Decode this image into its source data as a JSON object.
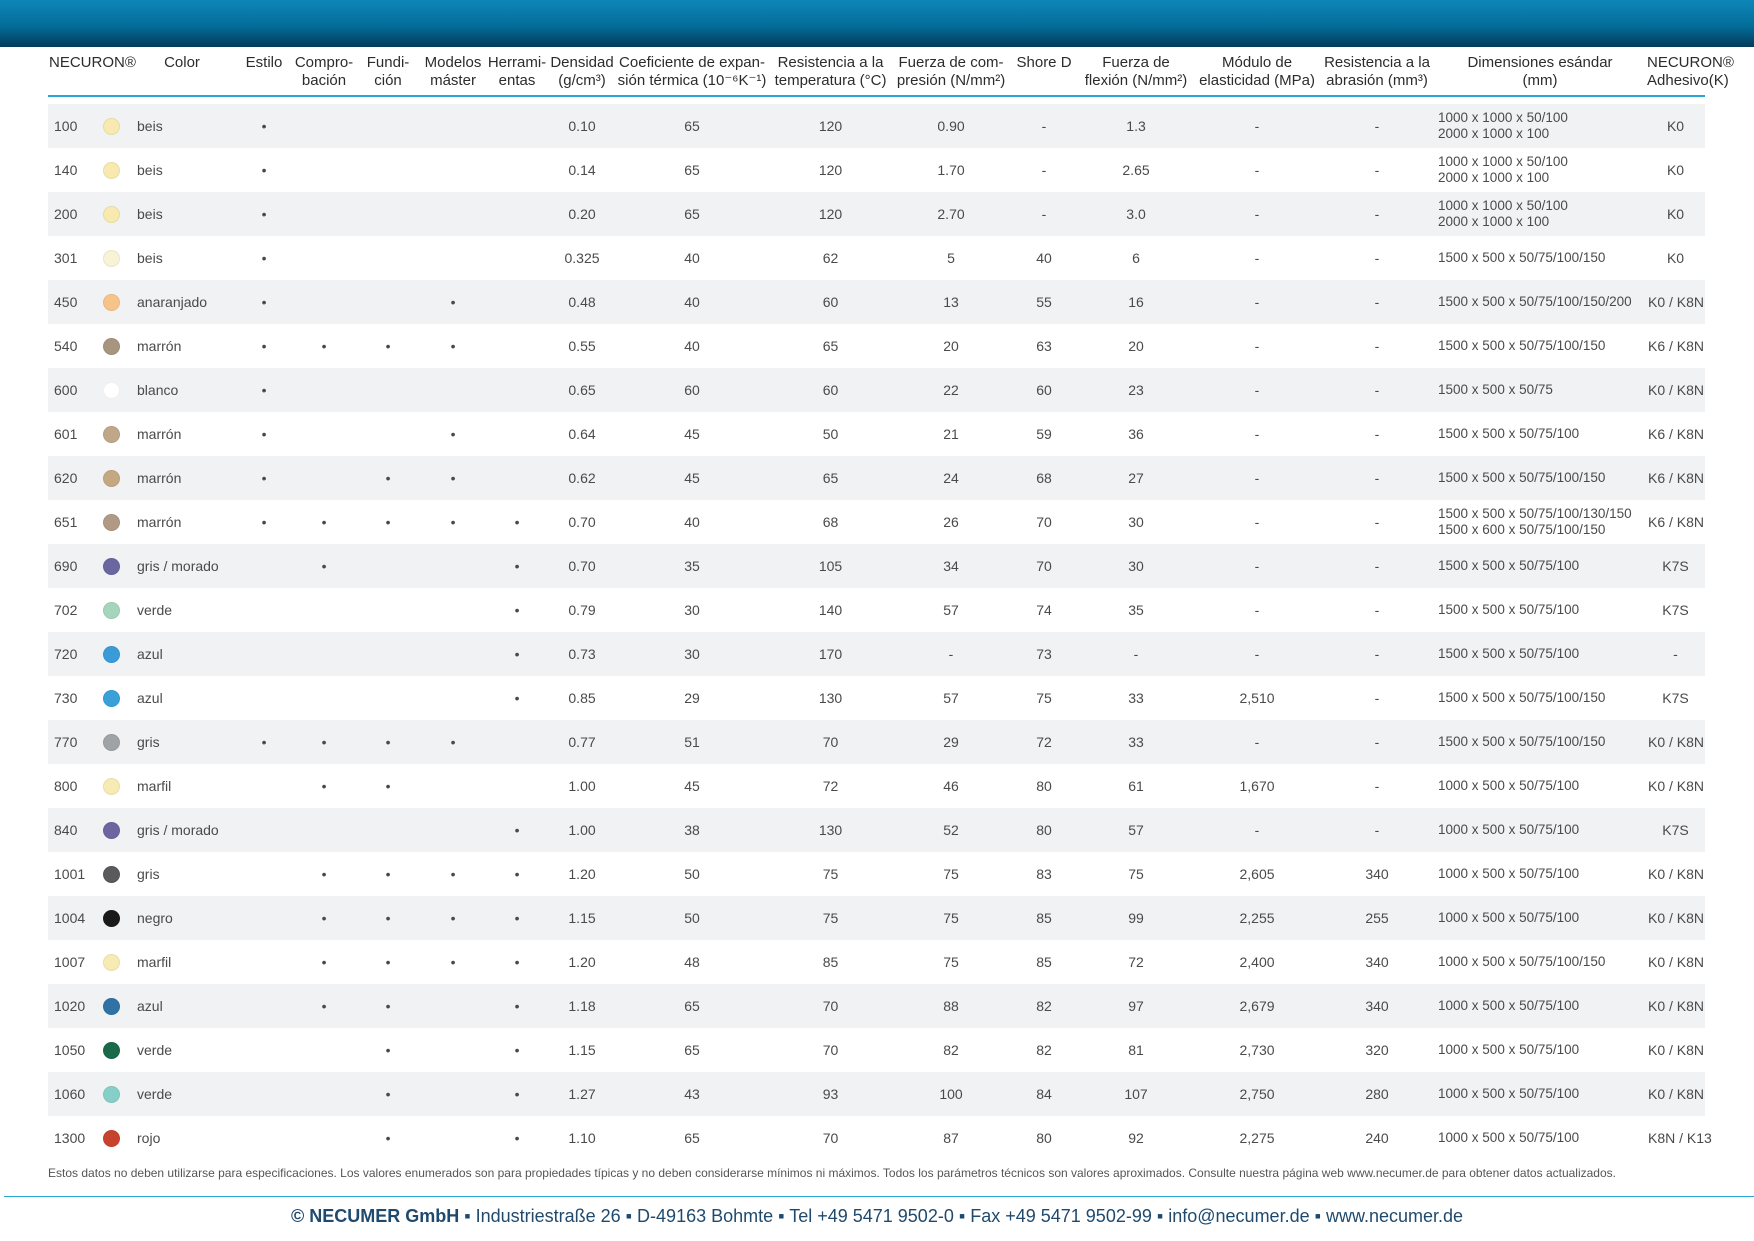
{
  "headers": [
    [
      "NECURON®",
      ""
    ],
    [
      "Color",
      ""
    ],
    [
      "Estilo",
      ""
    ],
    [
      "Compro-",
      "bación"
    ],
    [
      "Fundi-",
      "ción"
    ],
    [
      "Modelos",
      "máster"
    ],
    [
      "Herrami-",
      "entas"
    ],
    [
      "Densidad",
      "(g/cm³)"
    ],
    [
      "Coeficiente de expan-",
      "sión térmica (10⁻⁶K⁻¹)"
    ],
    [
      "Resistencia a la",
      "temperatura (°C)"
    ],
    [
      "Fuerza de com-",
      "presión (N/mm²)"
    ],
    [
      "Shore D",
      ""
    ],
    [
      "Fuerza de",
      "flexión (N/mm²)"
    ],
    [
      "Módulo de",
      "elasticidad (MPa)"
    ],
    [
      "Resistencia a la",
      "abrasión (mm³)"
    ],
    [
      "Dimensiones esándar",
      "(mm)"
    ],
    [
      "NECURON®",
      "Adhesivo(K)"
    ]
  ],
  "bullet": "•",
  "rows": [
    {
      "id": "100",
      "swatch": "#f7e9b0",
      "color": "beis",
      "estilo": "•",
      "comprobacion": "",
      "fundicion": "",
      "modelos": "",
      "herramientas": "",
      "densidad": "0.10",
      "coef": "65",
      "temp": "120",
      "compresion": "0.90",
      "shore": "-",
      "flexion": "1.3",
      "modulo": "-",
      "abrasion": "-",
      "dims": [
        "1000 x 1000 x 50/100",
        "2000 x 1000 x 100"
      ],
      "adhesivo": "K0"
    },
    {
      "id": "140",
      "swatch": "#f7e9b0",
      "color": "beis",
      "estilo": "•",
      "comprobacion": "",
      "fundicion": "",
      "modelos": "",
      "herramientas": "",
      "densidad": "0.14",
      "coef": "65",
      "temp": "120",
      "compresion": "1.70",
      "shore": "-",
      "flexion": "2.65",
      "modulo": "-",
      "abrasion": "-",
      "dims": [
        "1000 x 1000 x 50/100",
        "2000 x 1000 x 100"
      ],
      "adhesivo": "K0"
    },
    {
      "id": "200",
      "swatch": "#f7e9b0",
      "color": "beis",
      "estilo": "•",
      "comprobacion": "",
      "fundicion": "",
      "modelos": "",
      "herramientas": "",
      "densidad": "0.20",
      "coef": "65",
      "temp": "120",
      "compresion": "2.70",
      "shore": "-",
      "flexion": "3.0",
      "modulo": "-",
      "abrasion": "-",
      "dims": [
        "1000 x 1000 x 50/100",
        "2000 x 1000 x 100"
      ],
      "adhesivo": "K0"
    },
    {
      "id": "301",
      "swatch": "#f8f3d6",
      "color": "beis",
      "estilo": "•",
      "comprobacion": "",
      "fundicion": "",
      "modelos": "",
      "herramientas": "",
      "densidad": "0.325",
      "coef": "40",
      "temp": "62",
      "compresion": "5",
      "shore": "40",
      "flexion": "6",
      "modulo": "-",
      "abrasion": "-",
      "dims": [
        "1500 x 500 x 50/75/100/150"
      ],
      "adhesivo": "K0"
    },
    {
      "id": "450",
      "swatch": "#f5c48a",
      "color": "anaranjado",
      "estilo": "•",
      "comprobacion": "",
      "fundicion": "",
      "modelos": "•",
      "herramientas": "",
      "densidad": "0.48",
      "coef": "40",
      "temp": "60",
      "compresion": "13",
      "shore": "55",
      "flexion": "16",
      "modulo": "-",
      "abrasion": "-",
      "dims": [
        "1500 x 500 x 50/75/100/150/200"
      ],
      "adhesivo": "K0 / K8N"
    },
    {
      "id": "540",
      "swatch": "#a89580",
      "color": "marrón",
      "estilo": "•",
      "comprobacion": "•",
      "fundicion": "•",
      "modelos": "•",
      "herramientas": "",
      "densidad": "0.55",
      "coef": "40",
      "temp": "65",
      "compresion": "20",
      "shore": "63",
      "flexion": "20",
      "modulo": "-",
      "abrasion": "-",
      "dims": [
        "1500 x 500 x 50/75/100/150"
      ],
      "adhesivo": "K6 / K8N"
    },
    {
      "id": "600",
      "swatch": "#ffffff",
      "color": "blanco",
      "estilo": "•",
      "comprobacion": "",
      "fundicion": "",
      "modelos": "",
      "herramientas": "",
      "densidad": "0.65",
      "coef": "60",
      "temp": "60",
      "compresion": "22",
      "shore": "60",
      "flexion": "23",
      "modulo": "-",
      "abrasion": "-",
      "dims": [
        "1500 x 500 x 50/75"
      ],
      "adhesivo": "K0 / K8N"
    },
    {
      "id": "601",
      "swatch": "#bfa78a",
      "color": "marrón",
      "estilo": "•",
      "comprobacion": "",
      "fundicion": "",
      "modelos": "•",
      "herramientas": "",
      "densidad": "0.64",
      "coef": "45",
      "temp": "50",
      "compresion": "21",
      "shore": "59",
      "flexion": "36",
      "modulo": "-",
      "abrasion": "-",
      "dims": [
        "1500 x 500 x 50/75/100"
      ],
      "adhesivo": "K6 / K8N"
    },
    {
      "id": "620",
      "swatch": "#c4a882",
      "color": "marrón",
      "estilo": "•",
      "comprobacion": "",
      "fundicion": "•",
      "modelos": "•",
      "herramientas": "",
      "densidad": "0.62",
      "coef": "45",
      "temp": "65",
      "compresion": "24",
      "shore": "68",
      "flexion": "27",
      "modulo": "-",
      "abrasion": "-",
      "dims": [
        "1500 x 500 x 50/75/100/150"
      ],
      "adhesivo": "K6 / K8N"
    },
    {
      "id": "651",
      "swatch": "#b09a85",
      "color": "marrón",
      "estilo": "•",
      "comprobacion": "•",
      "fundicion": "•",
      "modelos": "•",
      "herramientas": "•",
      "densidad": "0.70",
      "coef": "40",
      "temp": "68",
      "compresion": "26",
      "shore": "70",
      "flexion": "30",
      "modulo": "-",
      "abrasion": "-",
      "dims": [
        "1500 x 500 x 50/75/100/130/150",
        "1500 x 600 x 50/75/100/150"
      ],
      "adhesivo": "K6 / K8N"
    },
    {
      "id": "690",
      "swatch": "#6a66a0",
      "color": "gris / morado",
      "estilo": "",
      "comprobacion": "•",
      "fundicion": "",
      "modelos": "",
      "herramientas": "•",
      "densidad": "0.70",
      "coef": "35",
      "temp": "105",
      "compresion": "34",
      "shore": "70",
      "flexion": "30",
      "modulo": "-",
      "abrasion": "-",
      "dims": [
        "1500 x 500 x 50/75/100"
      ],
      "adhesivo": "K7S"
    },
    {
      "id": "702",
      "swatch": "#a6d4bd",
      "color": "verde",
      "estilo": "",
      "comprobacion": "",
      "fundicion": "",
      "modelos": "",
      "herramientas": "•",
      "densidad": "0.79",
      "coef": "30",
      "temp": "140",
      "compresion": "57",
      "shore": "74",
      "flexion": "35",
      "modulo": "-",
      "abrasion": "-",
      "dims": [
        "1500 x 500 x 50/75/100"
      ],
      "adhesivo": "K7S"
    },
    {
      "id": "720",
      "swatch": "#3a9bd9",
      "color": "azul",
      "estilo": "",
      "comprobacion": "",
      "fundicion": "",
      "modelos": "",
      "herramientas": "•",
      "densidad": "0.73",
      "coef": "30",
      "temp": "170",
      "compresion": "-",
      "shore": "73",
      "flexion": "-",
      "modulo": "-",
      "abrasion": "-",
      "dims": [
        "1500 x 500 x 50/75/100"
      ],
      "adhesivo": "-"
    },
    {
      "id": "730",
      "swatch": "#3aa0d8",
      "color": "azul",
      "estilo": "",
      "comprobacion": "",
      "fundicion": "",
      "modelos": "",
      "herramientas": "•",
      "densidad": "0.85",
      "coef": "29",
      "temp": "130",
      "compresion": "57",
      "shore": "75",
      "flexion": "33",
      "modulo": "2,510",
      "abrasion": "-",
      "dims": [
        "1500 x 500 x 50/75/100/150"
      ],
      "adhesivo": "K7S"
    },
    {
      "id": "770",
      "swatch": "#9fa3a6",
      "color": "gris",
      "estilo": "•",
      "comprobacion": "•",
      "fundicion": "•",
      "modelos": "•",
      "herramientas": "",
      "densidad": "0.77",
      "coef": "51",
      "temp": "70",
      "compresion": "29",
      "shore": "72",
      "flexion": "33",
      "modulo": "-",
      "abrasion": "-",
      "dims": [
        "1500 x 500 x 50/75/100/150"
      ],
      "adhesivo": "K0 / K8N"
    },
    {
      "id": "800",
      "swatch": "#f8eab5",
      "color": "marfil",
      "estilo": "",
      "comprobacion": "•",
      "fundicion": "•",
      "modelos": "",
      "herramientas": "",
      "densidad": "1.00",
      "coef": "45",
      "temp": "72",
      "compresion": "46",
      "shore": "80",
      "flexion": "61",
      "modulo": "1,670",
      "abrasion": "-",
      "dims": [
        "1000 x 500 x 50/75/100"
      ],
      "adhesivo": "K0 / K8N"
    },
    {
      "id": "840",
      "swatch": "#6b66a0",
      "color": "gris / morado",
      "estilo": "",
      "comprobacion": "",
      "fundicion": "",
      "modelos": "",
      "herramientas": "•",
      "densidad": "1.00",
      "coef": "38",
      "temp": "130",
      "compresion": "52",
      "shore": "80",
      "flexion": "57",
      "modulo": "-",
      "abrasion": "-",
      "dims": [
        "1000 x 500 x 50/75/100"
      ],
      "adhesivo": "K7S"
    },
    {
      "id": "1001",
      "swatch": "#5a5a5c",
      "color": "gris",
      "estilo": "",
      "comprobacion": "•",
      "fundicion": "•",
      "modelos": "•",
      "herramientas": "•",
      "densidad": "1.20",
      "coef": "50",
      "temp": "75",
      "compresion": "75",
      "shore": "83",
      "flexion": "75",
      "modulo": "2,605",
      "abrasion": "340",
      "dims": [
        "1000 x 500 x 50/75/100"
      ],
      "adhesivo": "K0 / K8N"
    },
    {
      "id": "1004",
      "swatch": "#1a1a1a",
      "color": "negro",
      "estilo": "",
      "comprobacion": "•",
      "fundicion": "•",
      "modelos": "•",
      "herramientas": "•",
      "densidad": "1.15",
      "coef": "50",
      "temp": "75",
      "compresion": "75",
      "shore": "85",
      "flexion": "99",
      "modulo": "2,255",
      "abrasion": "255",
      "dims": [
        "1000 x 500 x 50/75/100"
      ],
      "adhesivo": "K0 / K8N"
    },
    {
      "id": "1007",
      "swatch": "#f8eab5",
      "color": "marfil",
      "estilo": "",
      "comprobacion": "•",
      "fundicion": "•",
      "modelos": "•",
      "herramientas": "•",
      "densidad": "1.20",
      "coef": "48",
      "temp": "85",
      "compresion": "75",
      "shore": "85",
      "flexion": "72",
      "modulo": "2,400",
      "abrasion": "340",
      "dims": [
        "1000 x 500 x 50/75/100/150"
      ],
      "adhesivo": "K0 / K8N"
    },
    {
      "id": "1020",
      "swatch": "#2f72a3",
      "color": "azul",
      "estilo": "",
      "comprobacion": "•",
      "fundicion": "•",
      "modelos": "",
      "herramientas": "•",
      "densidad": "1.18",
      "coef": "65",
      "temp": "70",
      "compresion": "88",
      "shore": "82",
      "flexion": "97",
      "modulo": "2,679",
      "abrasion": "340",
      "dims": [
        "1000 x 500 x 50/75/100"
      ],
      "adhesivo": "K0 / K8N"
    },
    {
      "id": "1050",
      "swatch": "#1a6a4a",
      "color": "verde",
      "estilo": "",
      "comprobacion": "",
      "fundicion": "•",
      "modelos": "",
      "herramientas": "•",
      "densidad": "1.15",
      "coef": "65",
      "temp": "70",
      "compresion": "82",
      "shore": "82",
      "flexion": "81",
      "modulo": "2,730",
      "abrasion": "320",
      "dims": [
        "1000 x 500 x 50/75/100"
      ],
      "adhesivo": "K0 / K8N"
    },
    {
      "id": "1060",
      "swatch": "#86cfc9",
      "color": "verde",
      "estilo": "",
      "comprobacion": "",
      "fundicion": "•",
      "modelos": "",
      "herramientas": "•",
      "densidad": "1.27",
      "coef": "43",
      "temp": "93",
      "compresion": "100",
      "shore": "84",
      "flexion": "107",
      "modulo": "2,750",
      "abrasion": "280",
      "dims": [
        "1000 x 500 x 50/75/100"
      ],
      "adhesivo": "K0 / K8N"
    },
    {
      "id": "1300",
      "swatch": "#c8432e",
      "color": "rojo",
      "estilo": "",
      "comprobacion": "",
      "fundicion": "•",
      "modelos": "",
      "herramientas": "•",
      "densidad": "1.10",
      "coef": "65",
      "temp": "70",
      "compresion": "87",
      "shore": "80",
      "flexion": "92",
      "modulo": "2,275",
      "abrasion": "240",
      "dims": [
        "1000 x 500 x 50/75/100"
      ],
      "adhesivo": "K8N / K13"
    }
  ],
  "disclaimer": "Estos datos no deben utilizarse para especificaciones. Los valores enumerados son para propiedades típicas y no deben considerarse mínimos ni máximos. Todos los parámetros técnicos son valores aproximados. Consulte nuestra página web www.necumer.de para obtener datos actualizados.",
  "footer": {
    "company": "© NECUMER GmbH",
    "rest": " ▪ Industriestraße 26 ▪ D-49163 Bohmte ▪ Tel +49 5471 9502-0 ▪ Fax +49 5471 9502-99 ▪ info@necumer.de ▪ www.necumer.de"
  },
  "colors": {
    "header_bar": "#036d9a",
    "accent_line": "#2aa3d6",
    "row_alt": "#f1f2f3",
    "footer_text": "#1f4a6e"
  }
}
